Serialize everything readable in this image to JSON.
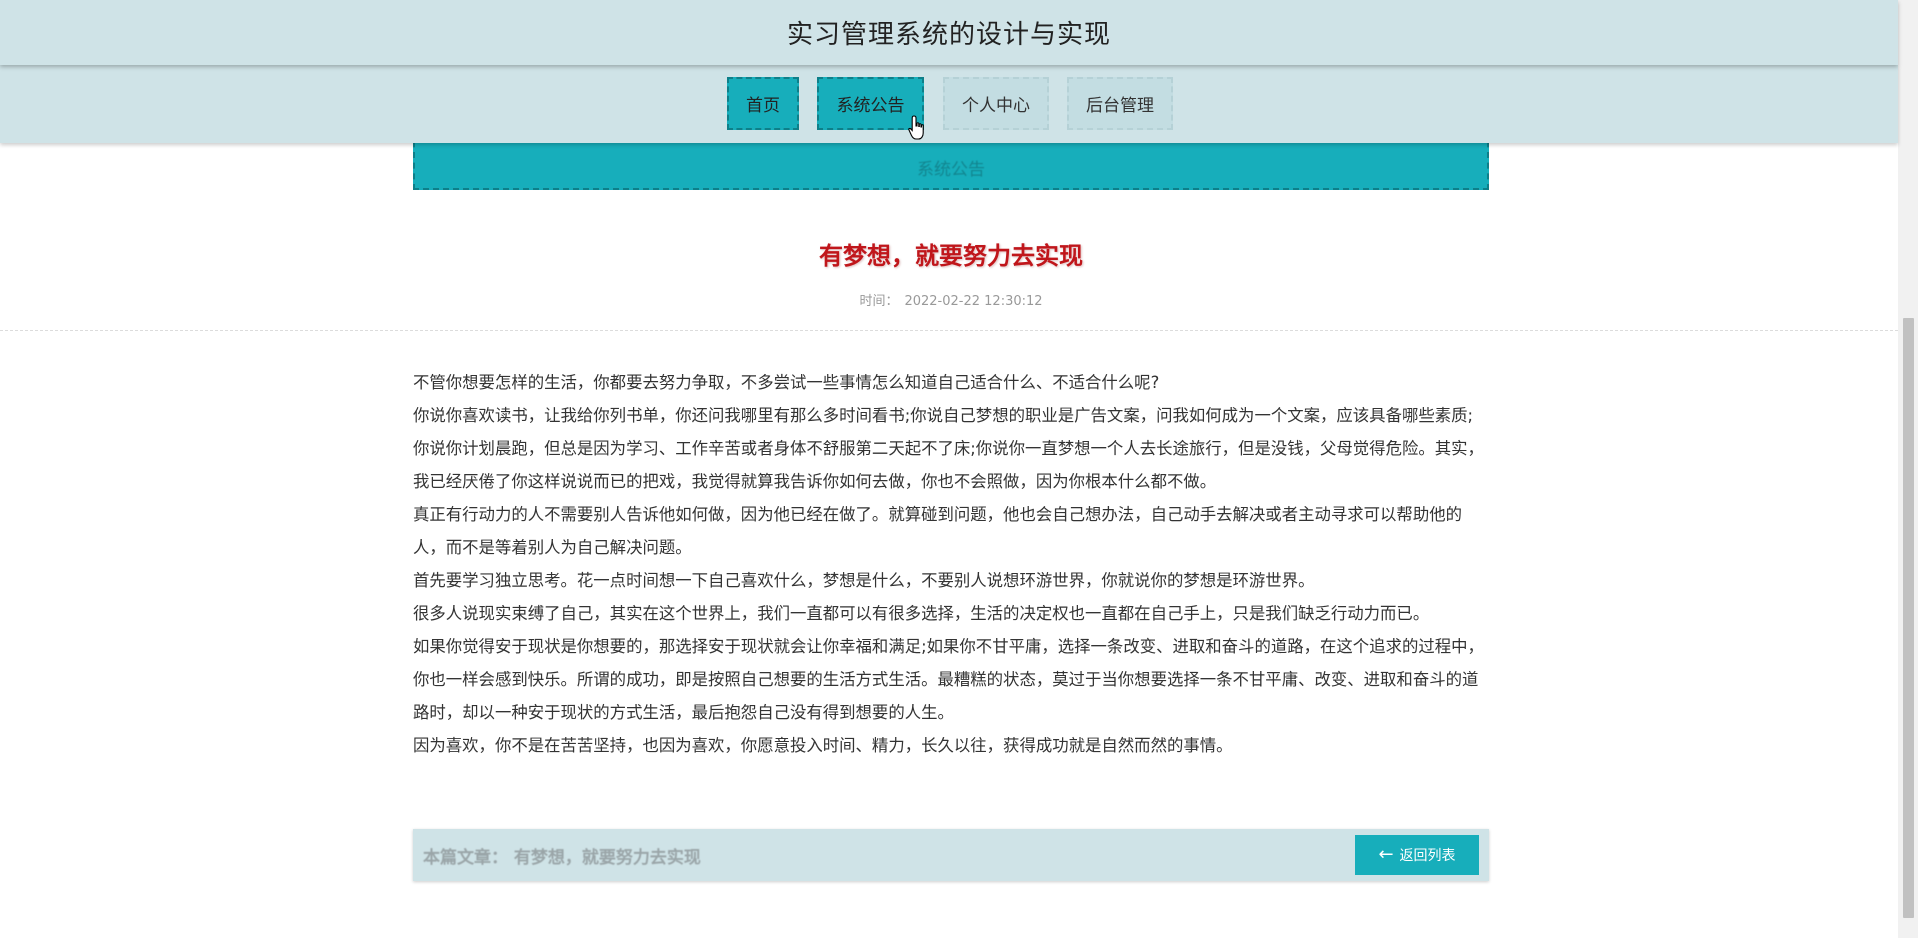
{
  "site": {
    "title": "实习管理系统的设计与实现"
  },
  "nav": {
    "items": [
      {
        "label": "首页"
      },
      {
        "label": "系统公告"
      },
      {
        "label": "个人中心"
      },
      {
        "label": "后台管理"
      }
    ],
    "active_index": 0
  },
  "banner": {
    "text": "系统公告"
  },
  "article": {
    "title": "有梦想，就要努力去实现",
    "time_label": "时间：",
    "time_value": "2022-02-22 12:30:12",
    "paragraphs": [
      "不管你想要怎样的生活，你都要去努力争取，不多尝试一些事情怎么知道自己适合什么、不适合什么呢?",
      "你说你喜欢读书，让我给你列书单，你还问我哪里有那么多时间看书;你说自己梦想的职业是广告文案，问我如何成为一个文案，应该具备哪些素质;你说你计划晨跑，但总是因为学习、工作辛苦或者身体不舒服第二天起不了床;你说你一直梦想一个人去长途旅行，但是没钱，父母觉得危险。其实，我已经厌倦了你这样说说而已的把戏，我觉得就算我告诉你如何去做，你也不会照做，因为你根本什么都不做。",
      "真正有行动力的人不需要别人告诉他如何做，因为他已经在做了。就算碰到问题，他也会自己想办法，自己动手去解决或者主动寻求可以帮助他的人，而不是等着别人为自己解决问题。",
      "首先要学习独立思考。花一点时间想一下自己喜欢什么，梦想是什么，不要别人说想环游世界，你就说你的梦想是环游世界。",
      "很多人说现实束缚了自己，其实在这个世界上，我们一直都可以有很多选择，生活的决定权也一直都在自己手上，只是我们缺乏行动力而已。",
      "如果你觉得安于现状是你想要的，那选择安于现状就会让你幸福和满足;如果你不甘平庸，选择一条改变、进取和奋斗的道路，在这个追求的过程中，你也一样会感到快乐。所谓的成功，即是按照自己想要的生活方式生活。最糟糕的状态，莫过于当你想要选择一条不甘平庸、改变、进取和奋斗的道路时，却以一种安于现状的方式生活，最后抱怨自己没有得到想要的人生。",
      "因为喜欢，你不是在苦苦坚持，也因为喜欢，你愿意投入时间、精力，长久以往，获得成功就是自然而然的事情。"
    ]
  },
  "footer": {
    "label": "本篇文章：  有梦想，就要努力去实现",
    "back_label": "返回列表",
    "back_icon": "arrow-left-icon"
  },
  "colors": {
    "teal": "#17aebb",
    "header_bg": "#cfe3e7",
    "title_red": "#c0161b"
  }
}
